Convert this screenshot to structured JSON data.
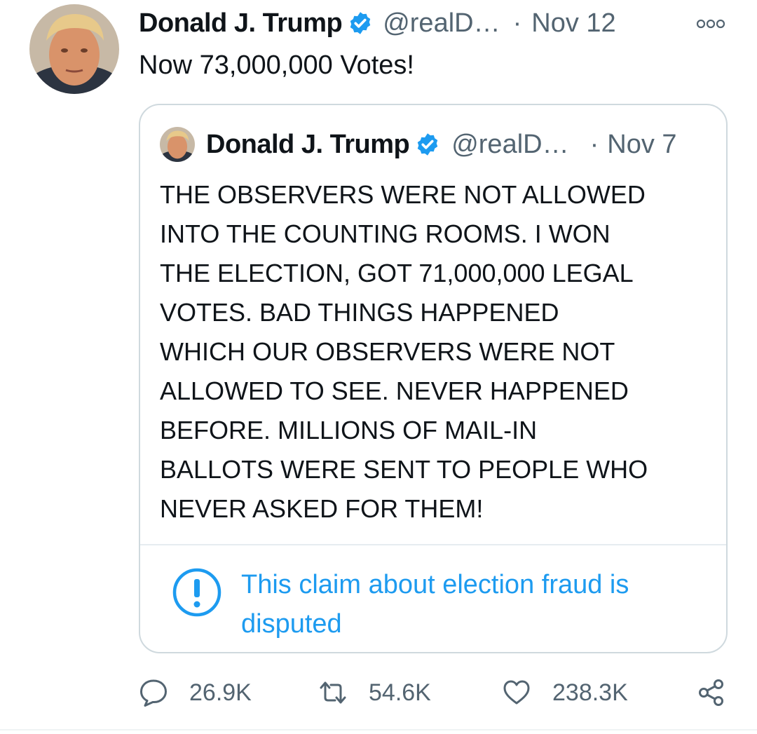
{
  "tweet": {
    "author_name": "Donald J. Trump",
    "handle": "@realD…",
    "separator": "·",
    "date": "Nov 12",
    "text": "Now 73,000,000 Votes!"
  },
  "quoted_tweet": {
    "author_name": "Donald J. Trump",
    "handle": "@realD…",
    "separator": "·",
    "date": "Nov 7",
    "text_lines": [
      "THE OBSERVERS WERE NOT ALLOWED",
      "INTO THE COUNTING ROOMS. I WON",
      "THE ELECTION, GOT 71,000,000 LEGAL",
      "VOTES. BAD THINGS HAPPENED",
      "WHICH OUR OBSERVERS WERE NOT",
      "ALLOWED TO SEE. NEVER HAPPENED",
      "BEFORE. MILLIONS OF MAIL-IN",
      "BALLOTS WERE SENT TO PEOPLE WHO",
      "NEVER ASKED FOR THEM!"
    ],
    "notice": {
      "icon": "exclamation-circle-icon",
      "text": "This claim about election fraud is disputed"
    }
  },
  "actions": {
    "reply_count": "26.9K",
    "retweet_count": "54.6K",
    "like_count": "238.3K"
  },
  "colors": {
    "accent": "#1d9bf0",
    "secondary_text": "#536471",
    "border": "#cfd9de"
  }
}
